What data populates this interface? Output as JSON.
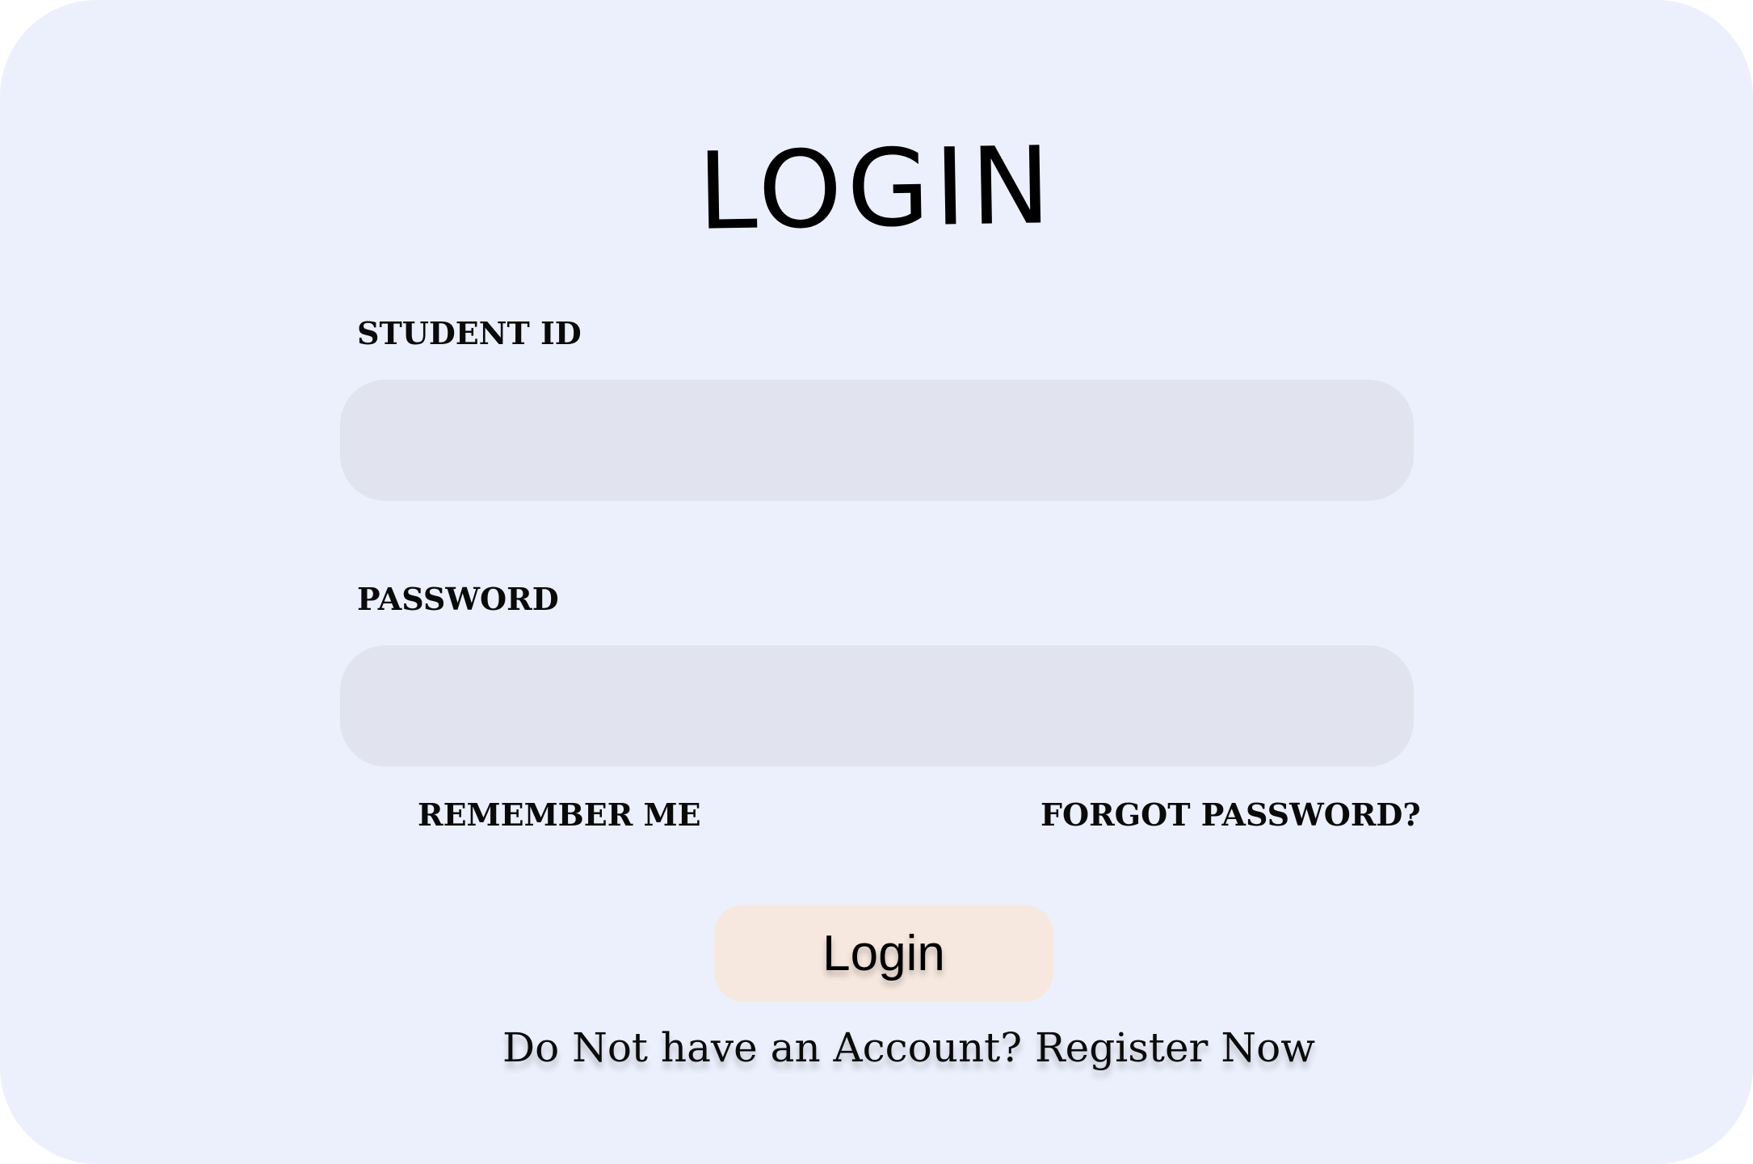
{
  "form": {
    "title": "LOGIN",
    "student_id_label": "STUDENT ID",
    "student_id_value": "",
    "password_label": "PASSWORD",
    "password_value": "",
    "remember_label": "REMEMBER ME",
    "forgot_label": "FORGOT PASSWORD?",
    "login_button_label": "Login",
    "register_prompt": "Do Not have an Account?",
    "register_link": "Register Now"
  },
  "colors": {
    "card_background": "#ecf0fc",
    "input_background": "#e1e4ee",
    "button_background": "#f7e8df",
    "text": "#000000"
  }
}
